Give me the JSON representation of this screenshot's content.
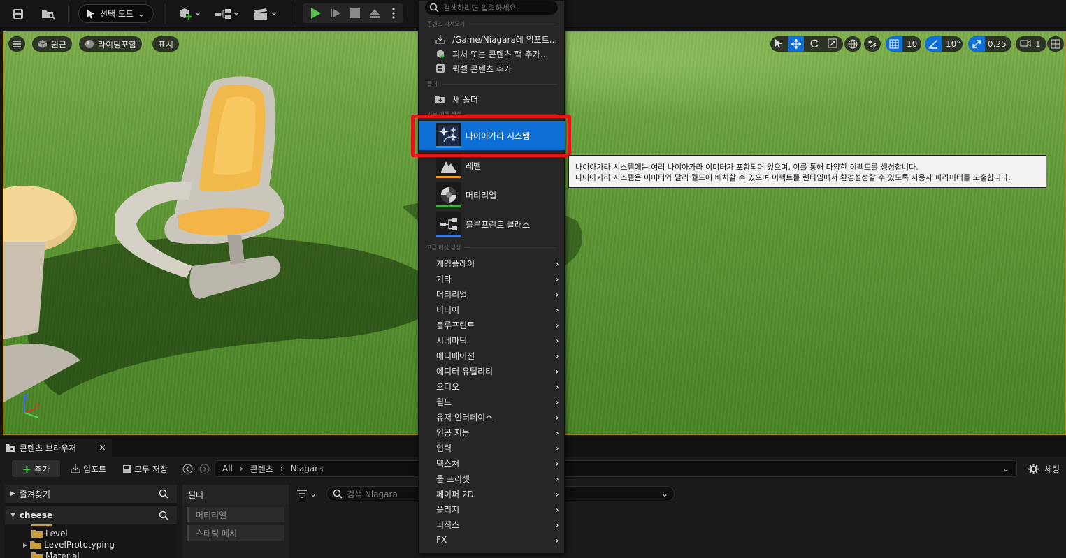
{
  "toolbar": {
    "mode_label": "선택 모드"
  },
  "viewport": {
    "perspective_label": "원근",
    "lighting_label": "라이팅포함",
    "show_label": "표시",
    "grid_value": "10",
    "angle_value": "10°",
    "scale_value": "0.25",
    "camera_value": "1",
    "axis_z": "Z",
    "axis_x": "X"
  },
  "menu": {
    "search_placeholder": "검색하려면 입력하세요.",
    "section_import": "콘텐츠 가져오기",
    "import_items": [
      {
        "label": "/Game/Niagara에 임포트..."
      },
      {
        "label": "피처 또는 콘텐츠 팩 추가..."
      },
      {
        "label": "퀵셀 콘텐츠 추가"
      }
    ],
    "section_folder": "폴더",
    "new_folder": "새 폴더",
    "section_basic": "기본 에셋 생성",
    "basic_assets": [
      {
        "label": "나이아가라 시스템",
        "color": "#1e9bff"
      },
      {
        "label": "레벨",
        "color": "#f09a1e"
      },
      {
        "label": "머티리얼",
        "color": "#3cb23c"
      },
      {
        "label": "블루프린트 클래스",
        "color": "#3c78e0"
      }
    ],
    "section_advanced": "고급 에셋 생성",
    "categories": [
      "게임플레이",
      "기타",
      "머티리얼",
      "미디어",
      "블루프린트",
      "시네마틱",
      "애니메이션",
      "에디터 유틸리티",
      "오디오",
      "월드",
      "유저 인터페이스",
      "인공 지능",
      "입력",
      "텍스처",
      "툴 프리셋",
      "페이퍼 2D",
      "폴리지",
      "피직스",
      "FX"
    ]
  },
  "tooltip": {
    "line1": "나이아가라 시스템에는 여러 나이아가라 이미터가 포함되어 있으며, 이를 통해 다양한 이펙트를 생성합니다.",
    "line2": "나이아가라 시스템은 이미터와 달리 월드에 배치할 수 있으며 이펙트를 런타임에서 환경설정할 수 있도록 사용자 파라미터를 노출합니다."
  },
  "content_browser": {
    "tab_label": "콘텐츠 브라우저",
    "add_label": "추가",
    "import_label": "임포트",
    "save_all_label": "모두 저장",
    "breadcrumb": [
      "All",
      "콘텐츠",
      "Niagara"
    ],
    "settings_label": "세팅",
    "favorites_label": "즐겨찾기",
    "project_label": "cheese",
    "folders": [
      {
        "label": "Level",
        "expandable": false
      },
      {
        "label": "LevelPrototyping",
        "expandable": true
      },
      {
        "label": "Material",
        "expandable": false
      }
    ],
    "filter_label": "필터",
    "filters": [
      "머티리얼",
      "스태틱 메시"
    ],
    "search_placeholder": "검색 Niagara"
  }
}
